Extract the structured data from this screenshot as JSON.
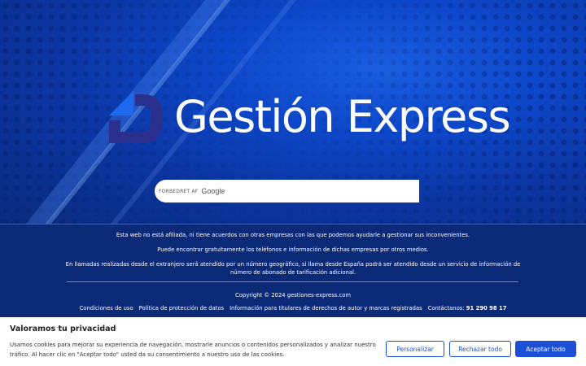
{
  "hero": {
    "brand_name": "Gestión Express",
    "search": {
      "powered_by": "FORBEDRET AF",
      "provider": "Google"
    },
    "colors": {
      "accent": "#1c6af0",
      "logo_dark": "#2a2e8c"
    }
  },
  "info": {
    "disclaimer": "Esta web no está afiliada, ni tiene acuerdos con otras empresas con las que podemos ayudarle a gestionar sus inconvenientes.",
    "find_info": "Puede encontrar gratuitamente los teléfonos e información de dichas empresas por otros medios.",
    "call_info": "En llamadas realizadas desde el extranjero será atendido por un número geográfico, si llama desde España podrá ser atendido desde un servicio de información de número de abonado de tarificación adicional.",
    "copyright": "Copyright © 2024 gestiones-express.com",
    "links": {
      "terms": "Condiciones de uso",
      "privacy": "Política de protección de datos",
      "rights_holders": "Información para titulares de derechos de autor y marcas registradas",
      "contact_label": "Contáctanos:",
      "contact_phone": "91 290 98 17"
    }
  },
  "cookie_banner": {
    "title": "Valoramos tu privacidad",
    "text": "Usamos cookies para mejorar su experiencia de navegación, mostrarle anuncios o contenidos personalizados y analizar nuestro tráfico. Al hacer clic en \"Aceptar todo\" usted da su consentimiento a nuestro uso de las cookies.",
    "customize_label": "Personalizar",
    "reject_label": "Rechazar todo",
    "accept_label": "Aceptar todo",
    "button_color": "#1c4fd6"
  }
}
